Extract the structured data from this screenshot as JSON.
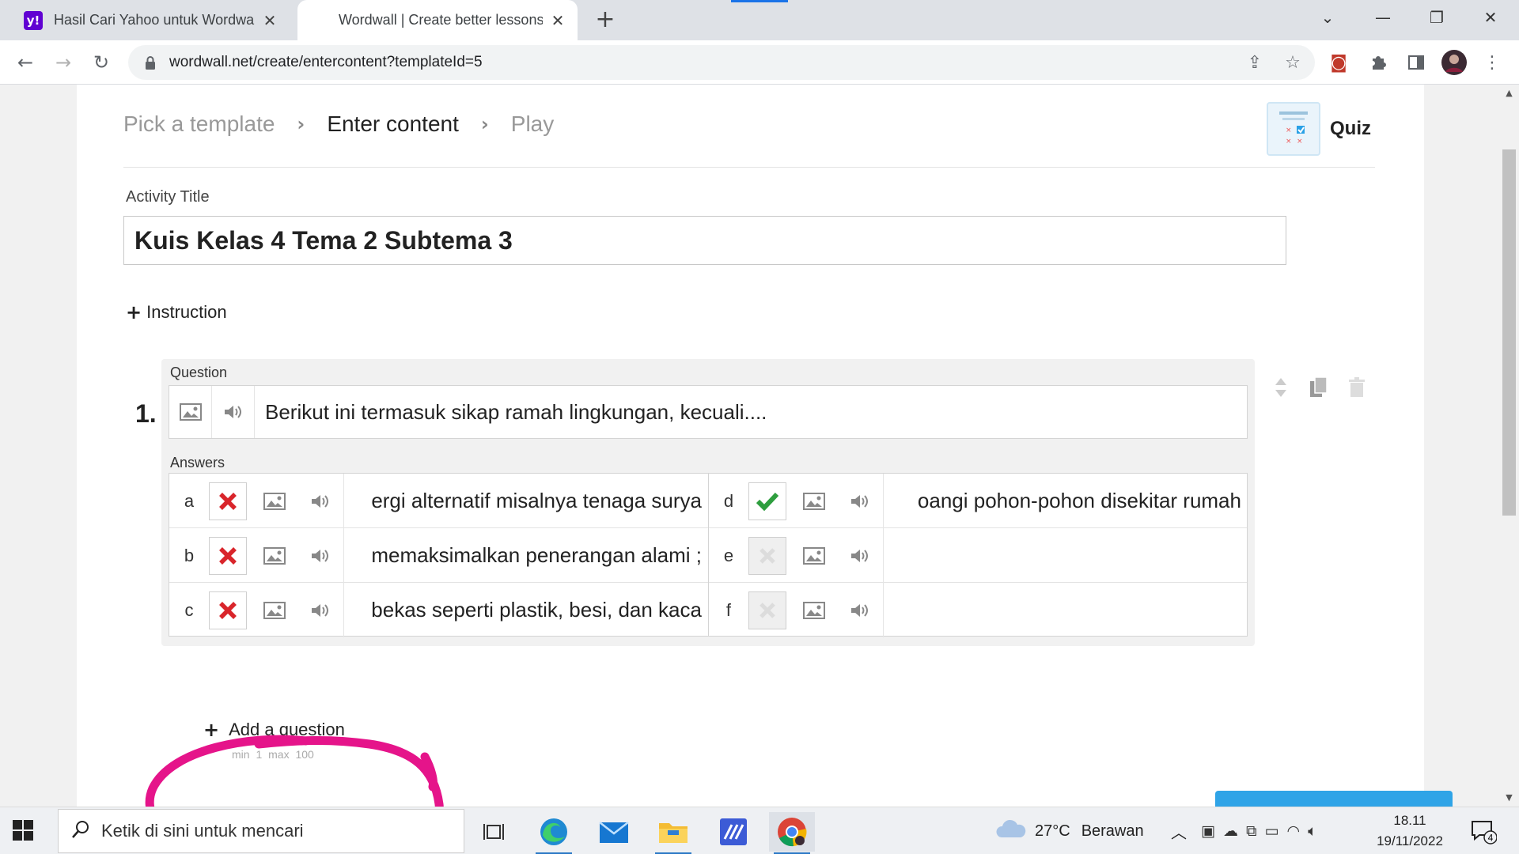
{
  "browser": {
    "tabs": [
      {
        "title": "Hasil Cari Yahoo untuk Wordwall",
        "favicon": "yahoo-icon"
      },
      {
        "title": "Wordwall | Create better lessons",
        "favicon": "wordwall-icon"
      }
    ],
    "url": "wordwall.net/create/entercontent?templateId=5"
  },
  "breadcrumb": {
    "step1": "Pick a template",
    "step2": "Enter content",
    "step3": "Play"
  },
  "template": {
    "name": "Quiz"
  },
  "activity": {
    "title_label": "Activity Title",
    "title_value": "Kuis Kelas 4 Tema 2 Subtema 3",
    "instruction_label": "Instruction"
  },
  "question": {
    "number": "1.",
    "label": "Question",
    "text": "Berikut ini termasuk sikap ramah lingkungan, kecuali....",
    "answers_label": "Answers",
    "answers": [
      {
        "letter": "a",
        "text": "ergi alternatif misalnya tenaga surya",
        "correct": false
      },
      {
        "letter": "b",
        "text": "; memaksimalkan penerangan alami",
        "correct": false
      },
      {
        "letter": "c",
        "text": "bekas seperti plastik, besi, dan kaca",
        "correct": false
      },
      {
        "letter": "d",
        "text": "oangi pohon-pohon disekitar rumah",
        "correct": true
      },
      {
        "letter": "e",
        "text": "",
        "correct": null
      },
      {
        "letter": "f",
        "text": "",
        "correct": null
      }
    ]
  },
  "add_question": {
    "label": "Add a question",
    "min": "min 1",
    "max": "max 100"
  },
  "taskbar": {
    "search_placeholder": "Ketik di sini untuk mencari",
    "weather_temp": "27°C",
    "weather_text": "Berawan",
    "time": "18.11",
    "date": "19/11/2022",
    "notification_count": "4"
  },
  "colors": {
    "correct_green": "#2e9e3e",
    "wrong_red": "#d9252b",
    "highlight_pink": "#e5148a",
    "accent_blue": "#2fa4e7"
  }
}
